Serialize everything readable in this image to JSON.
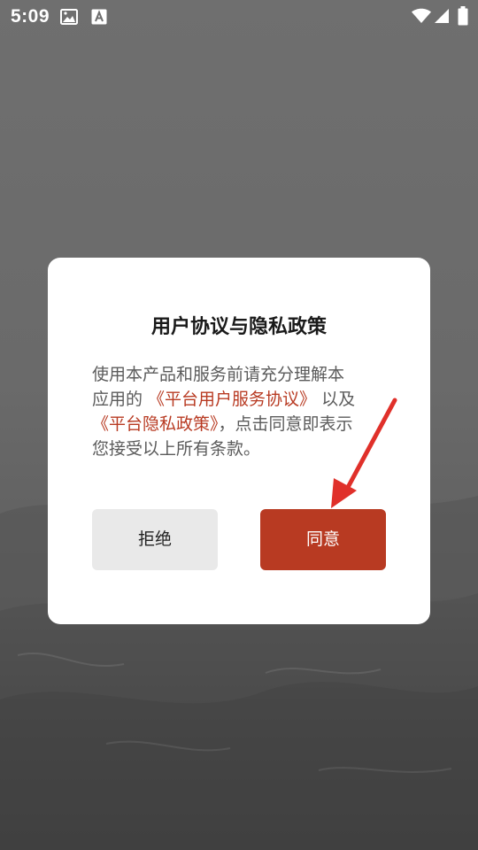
{
  "status_bar": {
    "time": "5:09",
    "icons": [
      "image-notification-icon",
      "font-notification-icon",
      "wifi-icon",
      "cell-signal-icon",
      "battery-icon"
    ]
  },
  "dialog": {
    "title": "用户协议与隐私政策",
    "body": {
      "line1": "使用本产品和服务前请充分理解本",
      "line2_prefix": "应用的 ",
      "service_agreement_link": "《平台用户服务协议》",
      "line2_suffix": " 以及",
      "privacy_policy_link": "《平台隐私政策》",
      "line3_suffix": "，点击同意即表示",
      "line4": "您接受以上所有条款。"
    },
    "reject_label": "拒绝",
    "agree_label": "同意"
  },
  "colors": {
    "accent": "#b83a22",
    "annotation_arrow": "#e0302a",
    "reject_button_bg": "#e9e9e9",
    "body_text": "#5b5b5b"
  }
}
